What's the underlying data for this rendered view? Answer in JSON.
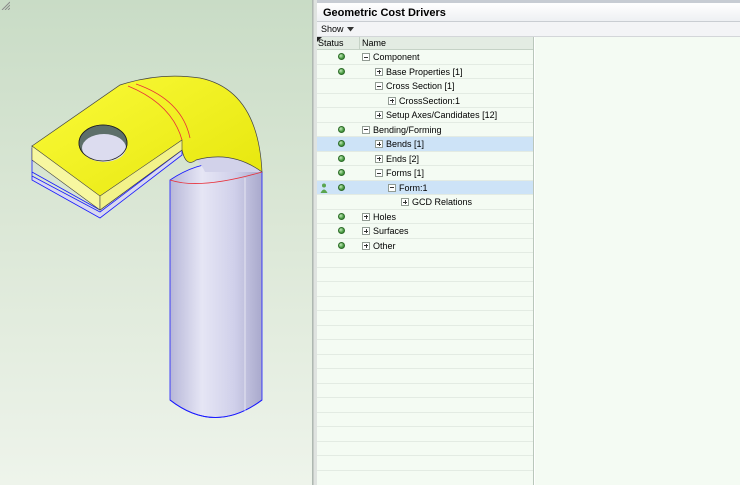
{
  "panel": {
    "title": "Geometric Cost Drivers",
    "show_menu_label": "Show"
  },
  "tree": {
    "columns": {
      "status": "Status",
      "name": "Name"
    },
    "rows": [
      {
        "label": "Component",
        "level": 0,
        "toggle": "minus",
        "status": true,
        "selected": false
      },
      {
        "label": "Base Properties [1]",
        "level": 1,
        "toggle": "plus",
        "status": true,
        "selected": false
      },
      {
        "label": "Cross Section [1]",
        "level": 1,
        "toggle": "minus",
        "status": false,
        "selected": false
      },
      {
        "label": "CrossSection:1",
        "level": 2,
        "toggle": "plus",
        "status": false,
        "selected": false
      },
      {
        "label": "Setup Axes/Candidates [12]",
        "level": 1,
        "toggle": "plus",
        "status": false,
        "selected": false
      },
      {
        "label": "Bending/Forming",
        "level": 0,
        "toggle": "minus",
        "status": true,
        "selected": false
      },
      {
        "label": "Bends [1]",
        "level": 1,
        "toggle": "plus",
        "status": true,
        "selected": true
      },
      {
        "label": "Ends [2]",
        "level": 1,
        "toggle": "plus",
        "status": true,
        "selected": false
      },
      {
        "label": "Forms [1]",
        "level": 1,
        "toggle": "minus",
        "status": true,
        "selected": false
      },
      {
        "label": "Form:1",
        "level": 2,
        "toggle": "minus",
        "status": true,
        "selected": true,
        "person": true
      },
      {
        "label": "GCD Relations",
        "level": 3,
        "toggle": "plus",
        "status": false,
        "selected": false
      },
      {
        "label": "Holes",
        "level": 0,
        "toggle": "plus",
        "status": true,
        "selected": false
      },
      {
        "label": "Surfaces",
        "level": 0,
        "toggle": "plus",
        "status": true,
        "selected": false
      },
      {
        "label": "Other",
        "level": 0,
        "toggle": "plus",
        "status": true,
        "selected": false
      }
    ],
    "empty_row_count": 15
  },
  "colors": {
    "part_face": "#f2f20a",
    "part_body": "#dcdcf0",
    "edge_blue": "#1a1aff",
    "edge_red": "#e8303a",
    "status_green": "#52a34a",
    "selection": "#cde3f7"
  }
}
